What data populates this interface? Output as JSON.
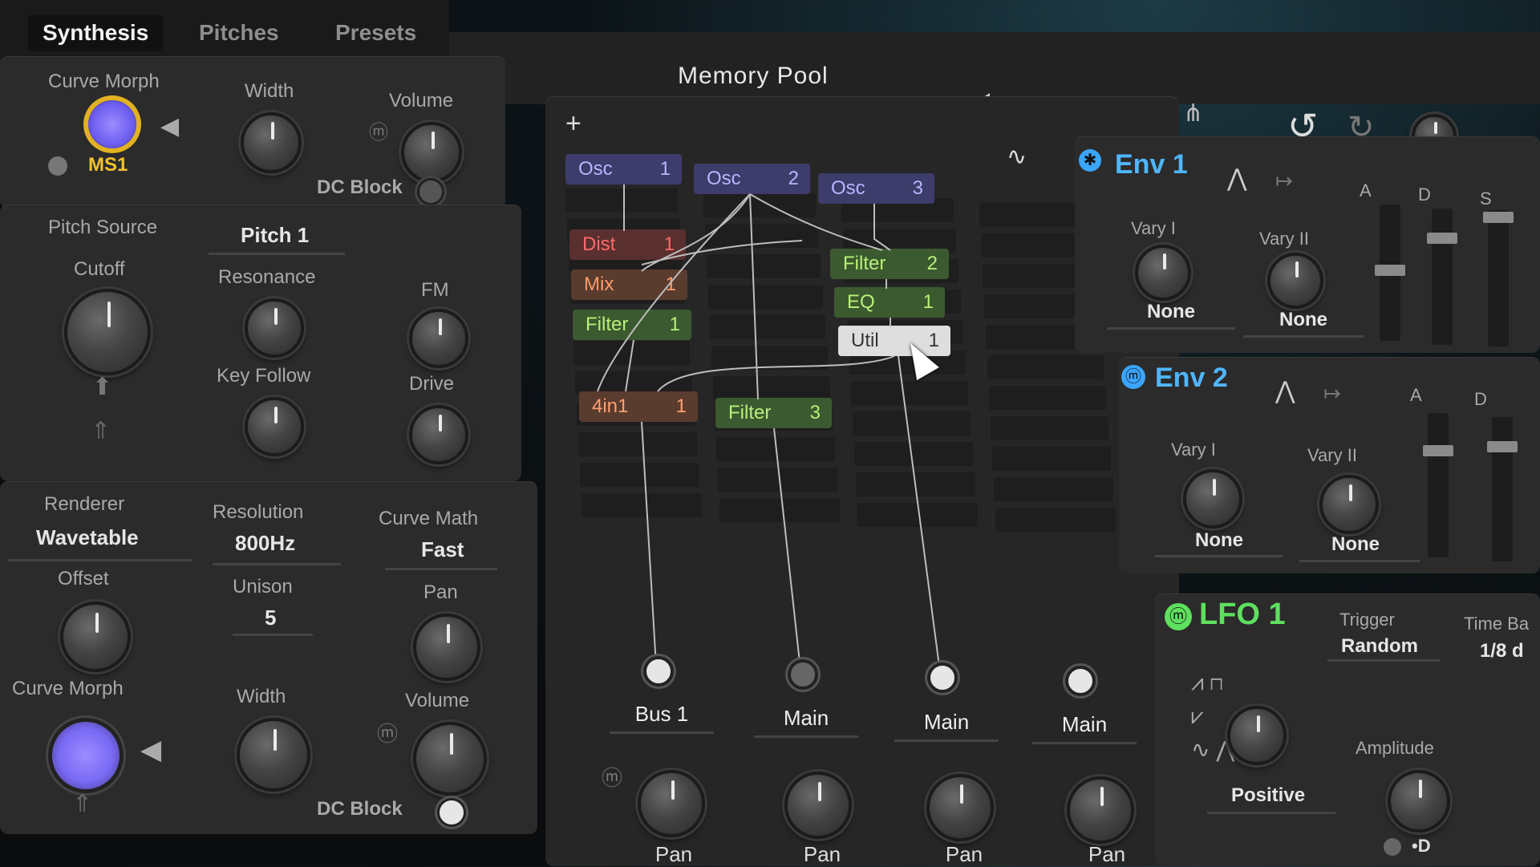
{
  "tabs": [
    "Synthesis",
    "Pitches",
    "Presets"
  ],
  "preset_name": "Memory Pool",
  "top_right_icons": [
    "prev-icon",
    "next-icon",
    "download-icon",
    "hierarchy-icon",
    "undo-icon",
    "redo-icon"
  ],
  "left": {
    "osc1": {
      "curve_morph": "Curve Morph",
      "curve_morph_value": "MS1",
      "width": "Width",
      "volume": "Volume",
      "dc_block": "DC Block"
    },
    "filter": {
      "pitch_source": "Pitch Source",
      "pitch_source_value": "Pitch 1",
      "cutoff": "Cutoff",
      "resonance": "Resonance",
      "fm": "FM",
      "key_follow": "Key Follow",
      "drive": "Drive"
    },
    "osc2": {
      "renderer": "Renderer",
      "renderer_value": "Wavetable",
      "resolution": "Resolution",
      "resolution_value": "800Hz",
      "curve_math": "Curve Math",
      "curve_math_value": "Fast",
      "offset": "Offset",
      "unison": "Unison",
      "unison_value": "5",
      "pan": "Pan",
      "curve_morph": "Curve Morph",
      "width": "Width",
      "volume": "Volume",
      "dc_block": "DC Block"
    }
  },
  "grid": {
    "add_label": "+",
    "nodes": [
      {
        "type": "Osc",
        "num": "1"
      },
      {
        "type": "Osc",
        "num": "2"
      },
      {
        "type": "Osc",
        "num": "3"
      },
      {
        "type": "Dist",
        "num": "1"
      },
      {
        "type": "Mix",
        "num": "1"
      },
      {
        "type": "Filter",
        "num": "1"
      },
      {
        "type": "Filter",
        "num": "2"
      },
      {
        "type": "EQ",
        "num": "1"
      },
      {
        "type": "Util",
        "num": "1"
      },
      {
        "type": "4in1",
        "num": "1"
      },
      {
        "type": "Filter",
        "num": "3"
      }
    ],
    "outputs": [
      "Bus 1",
      "Main",
      "Main",
      "Main"
    ],
    "pan_labels": [
      "Pan",
      "Pan",
      "Pan",
      "Pan"
    ]
  },
  "env1": {
    "title": "Env 1",
    "vary1": "Vary I",
    "vary2": "Vary II",
    "vary1_value": "None",
    "vary2_value": "None",
    "adsr": [
      "A",
      "D",
      "S"
    ]
  },
  "env2": {
    "title": "Env 2",
    "vary1": "Vary I",
    "vary2": "Vary II",
    "vary1_value": "None",
    "vary2_value": "None",
    "adsr": [
      "A",
      "D"
    ]
  },
  "lfo1": {
    "title": "LFO 1",
    "trigger": "Trigger",
    "trigger_value": "Random",
    "time_base": "Time Ba",
    "time_base_value": "1/8 d",
    "polarity": "Positive",
    "amplitude": "Amplitude"
  },
  "colors": {
    "accent_blue": "#4fb6ff",
    "lfo_green": "#5ee05e",
    "osc_purple": "#b8b6ff",
    "dist_red": "#ff6a6a",
    "filter_green": "#b8f07a",
    "morph_yellow": "#f2c12e"
  }
}
